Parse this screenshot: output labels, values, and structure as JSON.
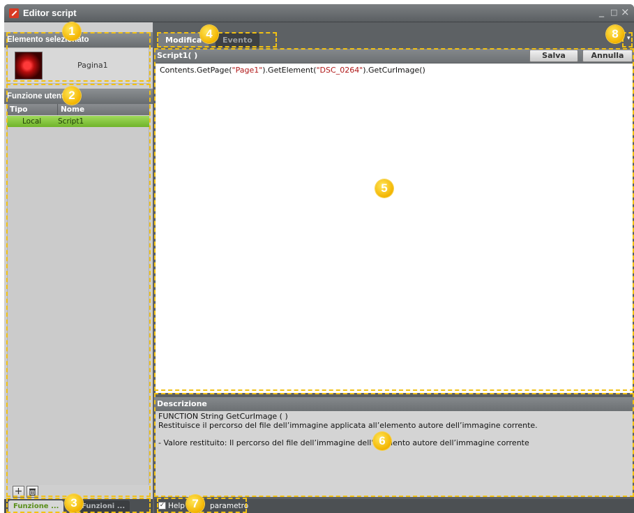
{
  "window": {
    "title": "Editor script",
    "minimize": "_",
    "maximize": "□",
    "close": "×",
    "icon": "script-editor-icon"
  },
  "element_panel": {
    "heading": "Elemento selezionato",
    "thumb_label": "Pagina1"
  },
  "functions_panel": {
    "heading": "Funzione utente",
    "columns": [
      "Tipo",
      "Nome"
    ],
    "rows": [
      {
        "type": "Local",
        "name": "Script1"
      }
    ],
    "add_icon": "plus-icon",
    "delete_icon": "trash-icon"
  },
  "left_tabs": [
    "Funzione ...",
    "Funzioni ..."
  ],
  "editor_tabs": [
    "Modifica",
    "Evento"
  ],
  "script": {
    "title": "Script1( )",
    "save_label": "Salva",
    "cancel_label": "Annulla",
    "code": {
      "p1": "Contents.GetPage(",
      "s1": "\"Page1\"",
      "p2": ").GetElement(",
      "s2": "\"DSC_0264\"",
      "p3": ").GetCurImage()"
    }
  },
  "description": {
    "heading": "Descrizione",
    "lines": [
      "FUNCTION String GetCurImage ( )",
      "Restituisce il percorso del file dell’immagine applicata all’elemento autore dell’immagine corrente.",
      "",
      "- Valore restituito: Il percorso del file dell’immagine dell’elemento autore dell’immagine corrente"
    ]
  },
  "status": {
    "help_label": "Help",
    "param_label": "parametro",
    "help_checked": true
  },
  "callouts": [
    "1",
    "2",
    "3",
    "4",
    "5",
    "6",
    "7",
    "8"
  ],
  "colors": {
    "accent_green": "#7cc237",
    "callout_yellow": "#f2c114",
    "chrome_gray": "#5f6366"
  }
}
